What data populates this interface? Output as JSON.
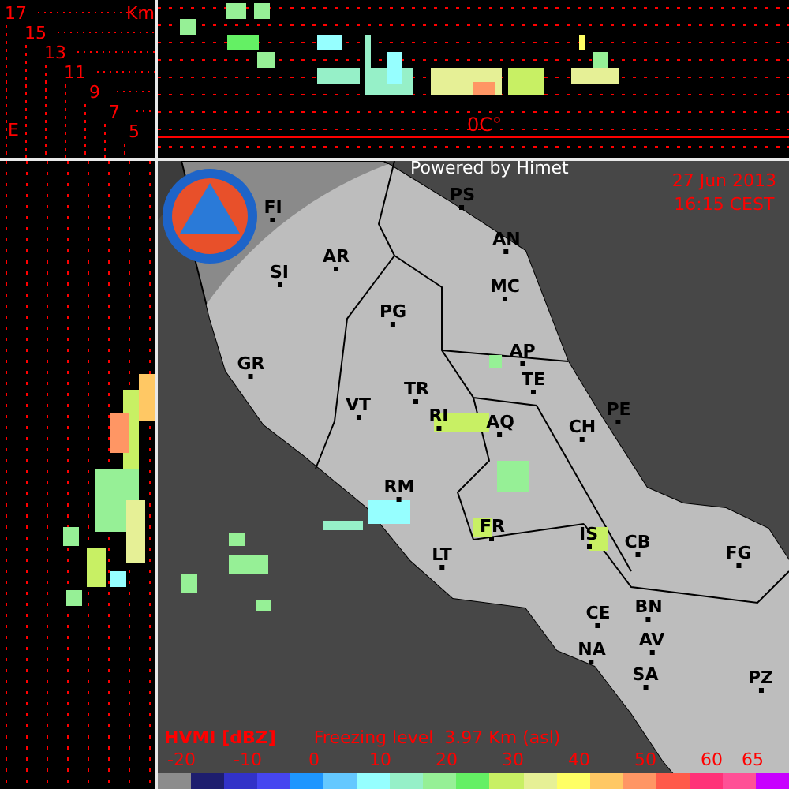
{
  "height_scale": {
    "unit": "Km",
    "axis_label": "E",
    "ticks": [
      "17",
      "15",
      "13",
      "11",
      "9",
      "7",
      "5"
    ]
  },
  "cross_section": {
    "freezing_marker": "0C°"
  },
  "map": {
    "credit": "Powered by Himet",
    "date": "27 Jun 2013",
    "time": "16:15 CEST",
    "cities": [
      {
        "label": "PS"
      },
      {
        "label": "AN"
      },
      {
        "label": "FI"
      },
      {
        "label": "AR"
      },
      {
        "label": "SI"
      },
      {
        "label": "MC"
      },
      {
        "label": "PG"
      },
      {
        "label": "GR"
      },
      {
        "label": "AP"
      },
      {
        "label": "TE"
      },
      {
        "label": "TR"
      },
      {
        "label": "VT"
      },
      {
        "label": "PE"
      },
      {
        "label": "RI"
      },
      {
        "label": "AQ"
      },
      {
        "label": "CH"
      },
      {
        "label": "RM"
      },
      {
        "label": "FR"
      },
      {
        "label": "IS"
      },
      {
        "label": "CB"
      },
      {
        "label": "FG"
      },
      {
        "label": "LT"
      },
      {
        "label": "CE"
      },
      {
        "label": "BN"
      },
      {
        "label": "AV"
      },
      {
        "label": "NA"
      },
      {
        "label": "SA"
      },
      {
        "label": "PZ"
      }
    ]
  },
  "legend": {
    "product": "HVMI [dBZ]",
    "freezing_level": "Freezing level  3.97 Km (asl)",
    "ticks": [
      "-20",
      "-10",
      "0",
      "10",
      "20",
      "30",
      "40",
      "50",
      "60",
      "65"
    ],
    "swatches": [
      {
        "color": "#8c8c8c"
      },
      {
        "color": "#1e1e6e"
      },
      {
        "color": "#3232c8"
      },
      {
        "color": "#4646f0"
      },
      {
        "color": "#1e96ff"
      },
      {
        "color": "#64c8ff"
      },
      {
        "color": "#96ffff"
      },
      {
        "color": "#96f0c8"
      },
      {
        "color": "#96f096"
      },
      {
        "color": "#64f064"
      },
      {
        "color": "#c8f064"
      },
      {
        "color": "#e6f096"
      },
      {
        "color": "#ffff64"
      },
      {
        "color": "#ffc864"
      },
      {
        "color": "#ff9664"
      },
      {
        "color": "#ff5a4a"
      },
      {
        "color": "#ff3278"
      },
      {
        "color": "#ff5096"
      },
      {
        "color": "#c800ff"
      }
    ]
  }
}
